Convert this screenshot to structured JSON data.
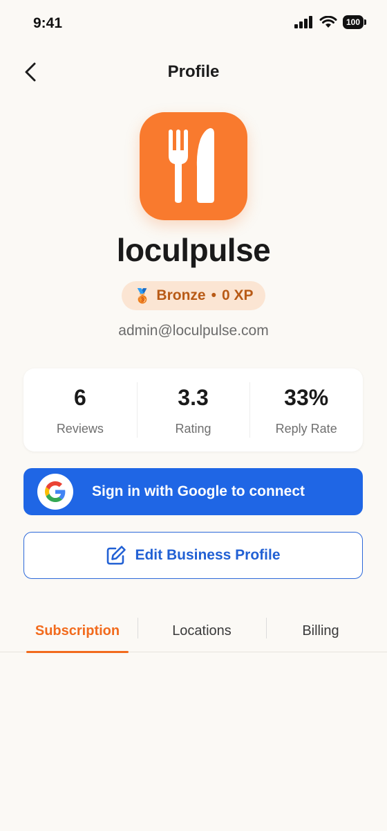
{
  "status_bar": {
    "time": "9:41",
    "battery": "100"
  },
  "nav": {
    "title": "Profile",
    "back_icon": "chevron-left-icon"
  },
  "app": {
    "icon": "fork-knife-icon",
    "icon_color": "#f97a2e",
    "name": "loculpulse"
  },
  "rank": {
    "emoji": "🥉",
    "tier": "Bronze",
    "separator": "•",
    "xp": "0 XP",
    "text_color": "#b85a16"
  },
  "email": "admin@loculpulse.com",
  "stats": [
    {
      "value": "6",
      "label": "Reviews"
    },
    {
      "value": "3.3",
      "label": "Rating"
    },
    {
      "value": "33%",
      "label": "Reply Rate"
    }
  ],
  "google_button": {
    "label": "Sign in with Google to connect",
    "color": "#1f66e5"
  },
  "edit_button": {
    "label": "Edit Business Profile",
    "icon": "edit-icon",
    "color": "#2160d4"
  },
  "tabs": [
    {
      "label": "Subscription",
      "active": true
    },
    {
      "label": "Locations",
      "active": false
    },
    {
      "label": "Billing",
      "active": false
    }
  ],
  "accent": "#f26b1d"
}
